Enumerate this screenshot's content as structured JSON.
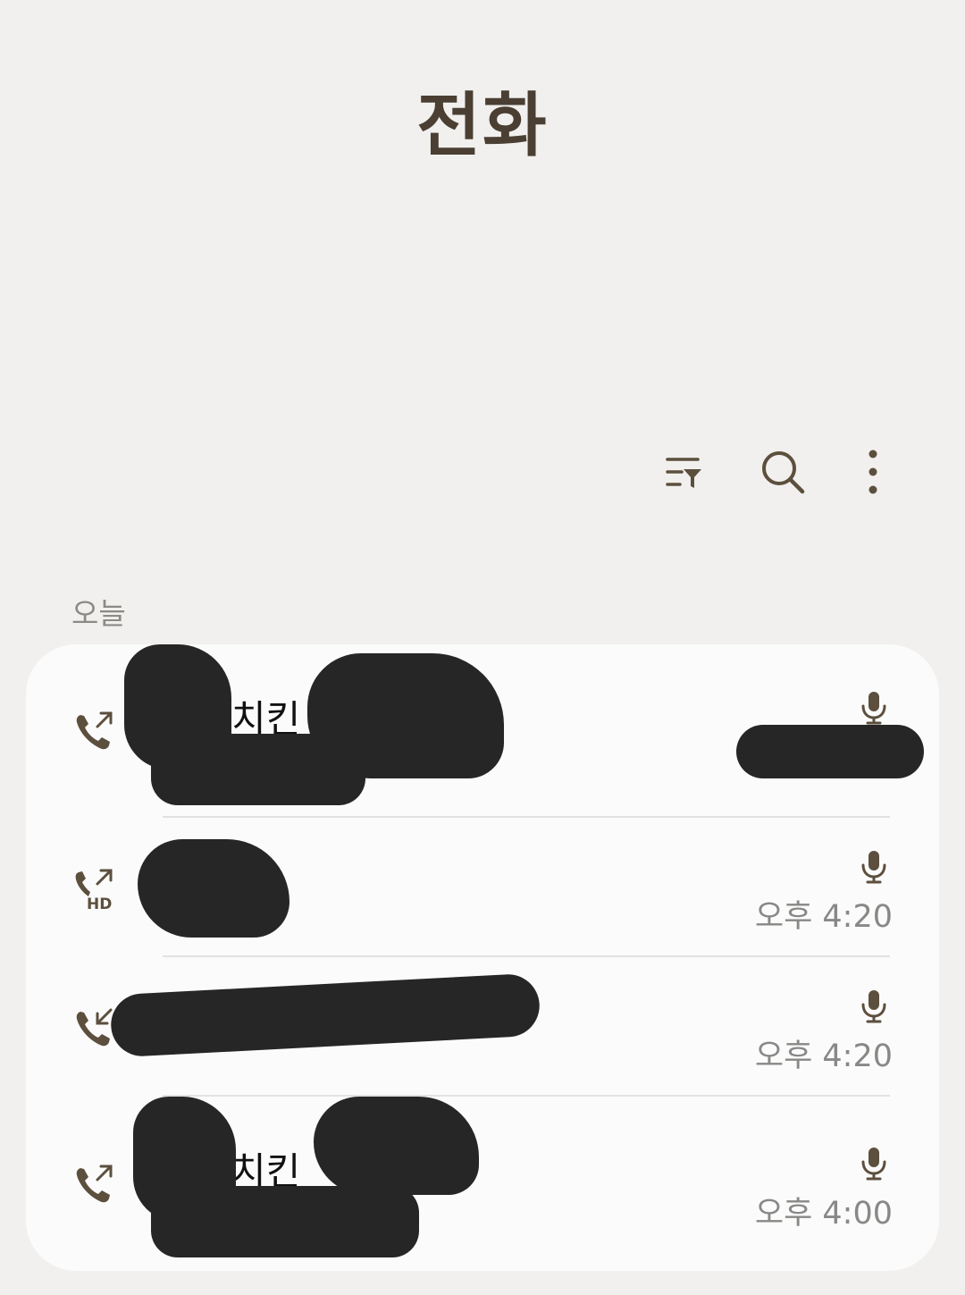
{
  "header": {
    "title": "전화"
  },
  "toolbar": {
    "filter_icon": "filter-list-icon",
    "search_icon": "search-icon",
    "more_icon": "more-vertical-icon"
  },
  "section": {
    "label": "오늘"
  },
  "calls": [
    {
      "name": "치킨",
      "direction": "outgoing",
      "hd": false,
      "recording": true,
      "time": ""
    },
    {
      "name": "",
      "direction": "outgoing",
      "hd": true,
      "hd_label": "HD",
      "recording": true,
      "time": "오후 4:20"
    },
    {
      "name": "",
      "direction": "incoming",
      "hd": false,
      "recording": true,
      "time": "오후 4:20"
    },
    {
      "name": "치킨",
      "direction": "outgoing",
      "hd": false,
      "recording": true,
      "time": "오후 4:00"
    }
  ],
  "colors": {
    "background": "#f1f0ee",
    "card": "#fbfbfb",
    "accent": "#5c4f3d",
    "muted_text": "#8a8886",
    "redaction": "#262626"
  }
}
